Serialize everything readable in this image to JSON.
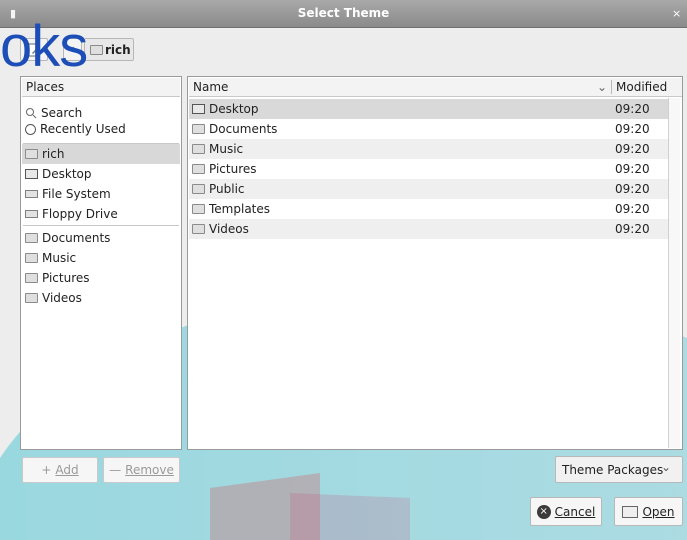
{
  "window": {
    "title": "Select Theme",
    "close_symbol": "×"
  },
  "path_bar": {
    "back_symbol": "‹",
    "current": "rich"
  },
  "places": {
    "header": "Places",
    "items": [
      {
        "label": "Search",
        "icon": "search-icon"
      },
      {
        "label": "Recently Used",
        "icon": "clock-icon"
      },
      {
        "label": "rich",
        "icon": "home-folder-icon",
        "selected": true
      },
      {
        "label": "Desktop",
        "icon": "desktop-icon"
      },
      {
        "label": "File System",
        "icon": "drive-icon"
      },
      {
        "label": "Floppy Drive",
        "icon": "floppy-icon"
      },
      {
        "label": "Documents",
        "icon": "folder-icon"
      },
      {
        "label": "Music",
        "icon": "folder-icon"
      },
      {
        "label": "Pictures",
        "icon": "folder-icon"
      },
      {
        "label": "Videos",
        "icon": "folder-icon"
      }
    ]
  },
  "files": {
    "columns": {
      "name": "Name",
      "modified": "Modified"
    },
    "rows": [
      {
        "name": "Desktop",
        "modified": "09:20",
        "icon": "desktop-icon"
      },
      {
        "name": "Documents",
        "modified": "09:20",
        "icon": "folder-icon"
      },
      {
        "name": "Music",
        "modified": "09:20",
        "icon": "folder-icon"
      },
      {
        "name": "Pictures",
        "modified": "09:20",
        "icon": "folder-icon"
      },
      {
        "name": "Public",
        "modified": "09:20",
        "icon": "folder-icon"
      },
      {
        "name": "Templates",
        "modified": "09:20",
        "icon": "folder-icon"
      },
      {
        "name": "Videos",
        "modified": "09:20",
        "icon": "folder-icon"
      }
    ]
  },
  "buttons": {
    "add": "Add",
    "remove": "Remove",
    "filter": "Theme Packages",
    "cancel": "Cancel",
    "open": "Open"
  },
  "overlay": {
    "watermark_text": "oks"
  },
  "colors": {
    "titlebar": "#8f8f8f",
    "accent": "#1d4eb8",
    "teal": "#49c1d0",
    "red": "#d94b4b"
  }
}
